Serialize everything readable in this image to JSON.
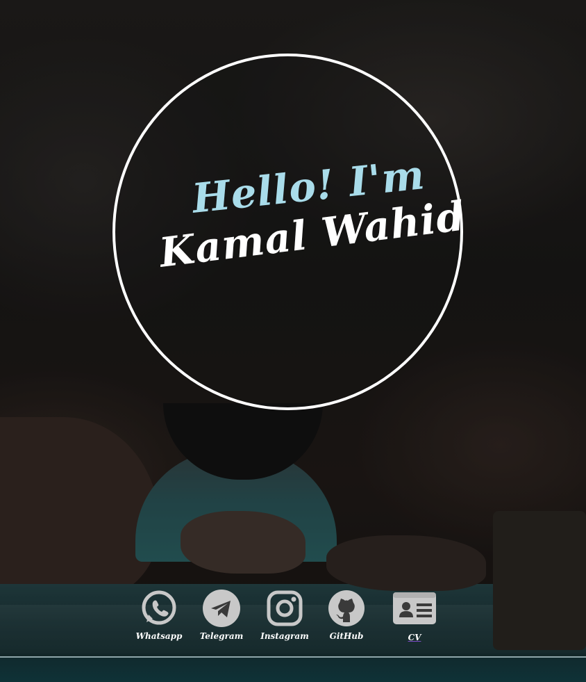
{
  "hero": {
    "greeting": "Hello! I'm",
    "name": "Kamal Wahid"
  },
  "socials": [
    {
      "label": "Whatsapp",
      "icon": "whatsapp-icon"
    },
    {
      "label": "Telegram",
      "icon": "telegram-icon"
    },
    {
      "label": "Instagram",
      "icon": "instagram-icon"
    },
    {
      "label": "GitHub",
      "icon": "github-icon"
    },
    {
      "label": "CV",
      "icon": "id-card-icon"
    }
  ],
  "colors": {
    "greeting": "#a9dcea",
    "name": "#ffffff",
    "icon": "#c8c8c8",
    "cv_underline": "#7d4cc9"
  }
}
